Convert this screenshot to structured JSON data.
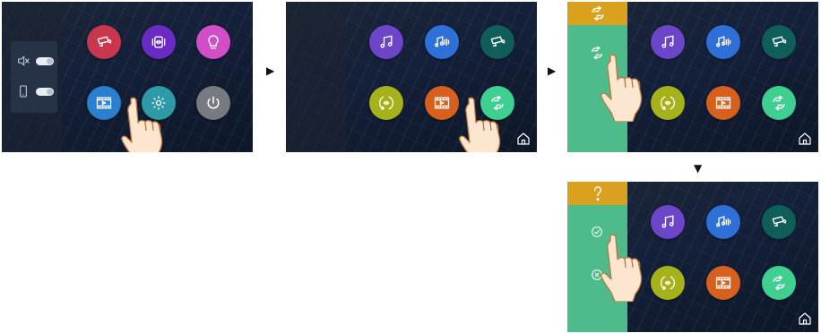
{
  "sequence_arrows": [
    "▶",
    "▶",
    "▼"
  ],
  "colors": {
    "red": "#c9374f",
    "purple": "#6a2bc4",
    "pink": "#d04fc7",
    "gray": "#777b80",
    "blue_light": "#2b7fcf",
    "teal": "#2e9aa8",
    "music_purple": "#6c45c9",
    "intercom_blue": "#2f6fd8",
    "camera_teal": "#0f5e5a",
    "lime": "#a5b21a",
    "orange": "#d8601f",
    "green": "#3fcf90",
    "panel_green": "#4dbc8a",
    "panel_gold": "#d9a11e"
  },
  "screens": [
    {
      "name": "screen-1",
      "side_panel_icons": [
        "mute-icon",
        "phone-icon"
      ],
      "apps": [
        "camera-icon",
        "intercom-icon",
        "bulb-icon",
        "video-icon",
        "settings-icon",
        "power-icon"
      ]
    },
    {
      "name": "screen-2",
      "apps": [
        "music-icon",
        "audio-icon",
        "camera-icon",
        "transfer-icon",
        "video-icon",
        "swap-icon"
      ]
    },
    {
      "name": "screen-3",
      "apps": [
        "music-icon",
        "audio-icon",
        "camera-icon",
        "transfer-icon",
        "video-icon",
        "swap-icon"
      ],
      "panel_icons": [
        "swap-icon",
        "swap-icon"
      ]
    },
    {
      "name": "screen-4",
      "apps": [
        "music-icon",
        "audio-icon",
        "camera-icon",
        "transfer-icon",
        "video-icon",
        "swap-icon"
      ],
      "panel_icons": [
        "question-icon",
        "confirm-icon",
        "cancel-icon"
      ]
    }
  ]
}
